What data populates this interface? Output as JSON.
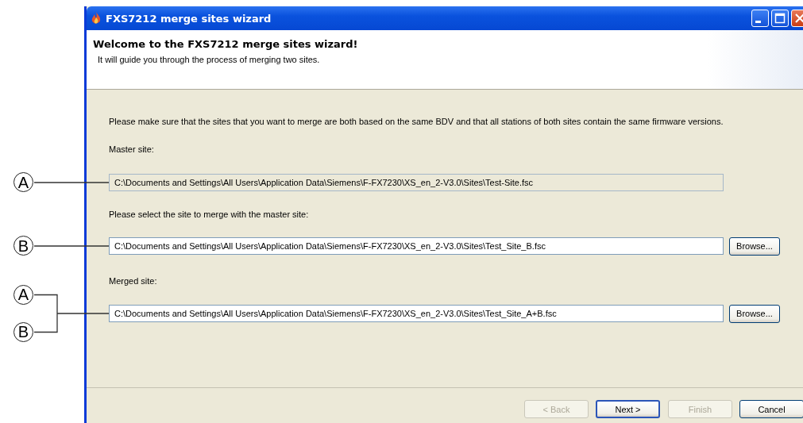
{
  "window": {
    "title": "FXS7212 merge sites wizard"
  },
  "header": {
    "title": "Welcome to the FXS7212 merge sites wizard!",
    "subtitle": "It will guide you through the process of merging two sites."
  },
  "instruction": "Please make sure that the sites that you want to merge are both based on the same BDV and that all stations of both sites contain the same firmware versions.",
  "fields": [
    {
      "label": "Master site:",
      "value": "C:\\Documents and Settings\\All Users\\Application Data\\Siemens\\F-FX7230\\XS_en_2-V3.0\\Sites\\Test-Site.fsc",
      "disabled": true,
      "callouts": [
        "A"
      ]
    },
    {
      "label": "Please select the site to merge with the master site:",
      "value": "C:\\Documents and Settings\\All Users\\Application Data\\Siemens\\F-FX7230\\XS_en_2-V3.0\\Sites\\Test_Site_B.fsc",
      "disabled": false,
      "browse": "Browse...",
      "callouts": [
        "B"
      ]
    },
    {
      "label": "Merged site:",
      "value": "C:\\Documents and Settings\\All Users\\Application Data\\Siemens\\F-FX7230\\XS_en_2-V3.0\\Sites\\Test_Site_A+B.fsc",
      "disabled": false,
      "browse": "Browse...",
      "callouts": [
        "A",
        "B"
      ]
    }
  ],
  "buttons": [
    {
      "label": "< Back",
      "disabled": true,
      "default": false
    },
    {
      "label": "Next >",
      "disabled": false,
      "default": true
    },
    {
      "label": "Finish",
      "disabled": true,
      "default": false
    },
    {
      "label": "Cancel",
      "disabled": false,
      "default": false
    }
  ]
}
